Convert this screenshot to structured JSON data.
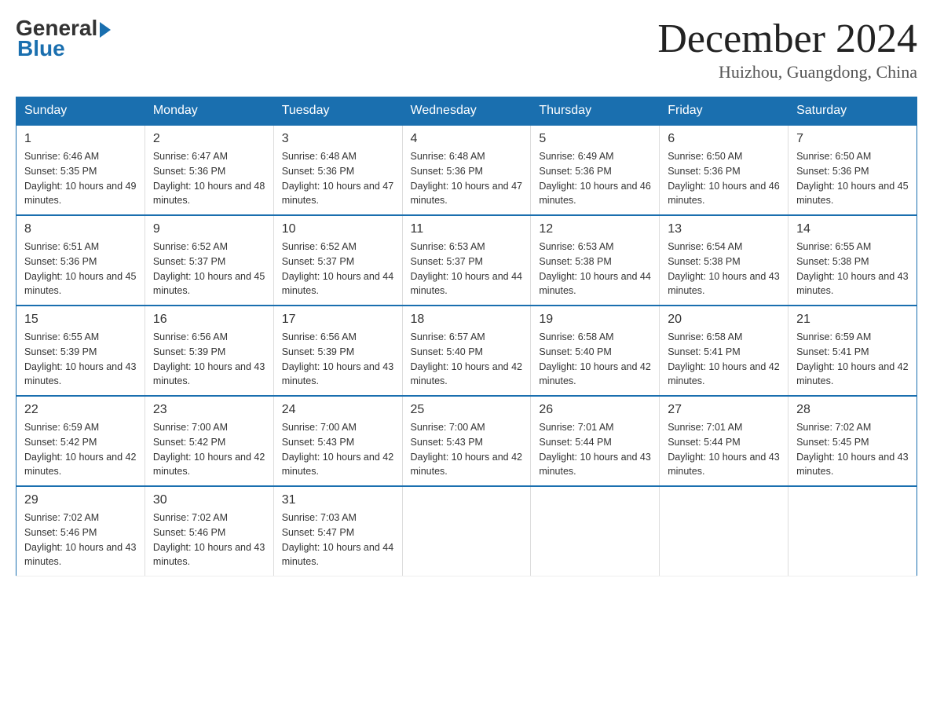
{
  "logo": {
    "text_general": "General",
    "text_blue": "Blue"
  },
  "title": "December 2024",
  "subtitle": "Huizhou, Guangdong, China",
  "days_of_week": [
    "Sunday",
    "Monday",
    "Tuesday",
    "Wednesday",
    "Thursday",
    "Friday",
    "Saturday"
  ],
  "weeks": [
    [
      {
        "day": "1",
        "sunrise": "6:46 AM",
        "sunset": "5:35 PM",
        "daylight": "10 hours and 49 minutes."
      },
      {
        "day": "2",
        "sunrise": "6:47 AM",
        "sunset": "5:36 PM",
        "daylight": "10 hours and 48 minutes."
      },
      {
        "day": "3",
        "sunrise": "6:48 AM",
        "sunset": "5:36 PM",
        "daylight": "10 hours and 47 minutes."
      },
      {
        "day": "4",
        "sunrise": "6:48 AM",
        "sunset": "5:36 PM",
        "daylight": "10 hours and 47 minutes."
      },
      {
        "day": "5",
        "sunrise": "6:49 AM",
        "sunset": "5:36 PM",
        "daylight": "10 hours and 46 minutes."
      },
      {
        "day": "6",
        "sunrise": "6:50 AM",
        "sunset": "5:36 PM",
        "daylight": "10 hours and 46 minutes."
      },
      {
        "day": "7",
        "sunrise": "6:50 AM",
        "sunset": "5:36 PM",
        "daylight": "10 hours and 45 minutes."
      }
    ],
    [
      {
        "day": "8",
        "sunrise": "6:51 AM",
        "sunset": "5:36 PM",
        "daylight": "10 hours and 45 minutes."
      },
      {
        "day": "9",
        "sunrise": "6:52 AM",
        "sunset": "5:37 PM",
        "daylight": "10 hours and 45 minutes."
      },
      {
        "day": "10",
        "sunrise": "6:52 AM",
        "sunset": "5:37 PM",
        "daylight": "10 hours and 44 minutes."
      },
      {
        "day": "11",
        "sunrise": "6:53 AM",
        "sunset": "5:37 PM",
        "daylight": "10 hours and 44 minutes."
      },
      {
        "day": "12",
        "sunrise": "6:53 AM",
        "sunset": "5:38 PM",
        "daylight": "10 hours and 44 minutes."
      },
      {
        "day": "13",
        "sunrise": "6:54 AM",
        "sunset": "5:38 PM",
        "daylight": "10 hours and 43 minutes."
      },
      {
        "day": "14",
        "sunrise": "6:55 AM",
        "sunset": "5:38 PM",
        "daylight": "10 hours and 43 minutes."
      }
    ],
    [
      {
        "day": "15",
        "sunrise": "6:55 AM",
        "sunset": "5:39 PM",
        "daylight": "10 hours and 43 minutes."
      },
      {
        "day": "16",
        "sunrise": "6:56 AM",
        "sunset": "5:39 PM",
        "daylight": "10 hours and 43 minutes."
      },
      {
        "day": "17",
        "sunrise": "6:56 AM",
        "sunset": "5:39 PM",
        "daylight": "10 hours and 43 minutes."
      },
      {
        "day": "18",
        "sunrise": "6:57 AM",
        "sunset": "5:40 PM",
        "daylight": "10 hours and 42 minutes."
      },
      {
        "day": "19",
        "sunrise": "6:58 AM",
        "sunset": "5:40 PM",
        "daylight": "10 hours and 42 minutes."
      },
      {
        "day": "20",
        "sunrise": "6:58 AM",
        "sunset": "5:41 PM",
        "daylight": "10 hours and 42 minutes."
      },
      {
        "day": "21",
        "sunrise": "6:59 AM",
        "sunset": "5:41 PM",
        "daylight": "10 hours and 42 minutes."
      }
    ],
    [
      {
        "day": "22",
        "sunrise": "6:59 AM",
        "sunset": "5:42 PM",
        "daylight": "10 hours and 42 minutes."
      },
      {
        "day": "23",
        "sunrise": "7:00 AM",
        "sunset": "5:42 PM",
        "daylight": "10 hours and 42 minutes."
      },
      {
        "day": "24",
        "sunrise": "7:00 AM",
        "sunset": "5:43 PM",
        "daylight": "10 hours and 42 minutes."
      },
      {
        "day": "25",
        "sunrise": "7:00 AM",
        "sunset": "5:43 PM",
        "daylight": "10 hours and 42 minutes."
      },
      {
        "day": "26",
        "sunrise": "7:01 AM",
        "sunset": "5:44 PM",
        "daylight": "10 hours and 43 minutes."
      },
      {
        "day": "27",
        "sunrise": "7:01 AM",
        "sunset": "5:44 PM",
        "daylight": "10 hours and 43 minutes."
      },
      {
        "day": "28",
        "sunrise": "7:02 AM",
        "sunset": "5:45 PM",
        "daylight": "10 hours and 43 minutes."
      }
    ],
    [
      {
        "day": "29",
        "sunrise": "7:02 AM",
        "sunset": "5:46 PM",
        "daylight": "10 hours and 43 minutes."
      },
      {
        "day": "30",
        "sunrise": "7:02 AM",
        "sunset": "5:46 PM",
        "daylight": "10 hours and 43 minutes."
      },
      {
        "day": "31",
        "sunrise": "7:03 AM",
        "sunset": "5:47 PM",
        "daylight": "10 hours and 44 minutes."
      },
      null,
      null,
      null,
      null
    ]
  ]
}
